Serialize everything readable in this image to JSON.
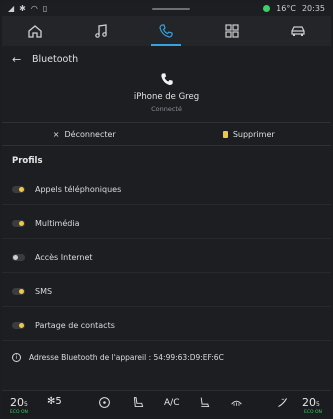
{
  "status": {
    "temp": "16°C",
    "time": "20:35"
  },
  "nav": {
    "tabs": [
      {
        "name": "home",
        "active": false
      },
      {
        "name": "music",
        "active": false
      },
      {
        "name": "phone",
        "active": true
      },
      {
        "name": "apps",
        "active": false
      },
      {
        "name": "vehicle",
        "active": false
      }
    ]
  },
  "header": {
    "title": "Bluetooth"
  },
  "device": {
    "name": "iPhone de Greg",
    "state": "Connecté"
  },
  "actions": {
    "disconnect": "Déconnecter",
    "delete": "Supprimer"
  },
  "profiles": {
    "title": "Profils",
    "items": [
      {
        "label": "Appels téléphoniques",
        "on": true
      },
      {
        "label": "Multimédia",
        "on": true
      },
      {
        "label": "Accès Internet",
        "on": false
      },
      {
        "label": "SMS",
        "on": true
      },
      {
        "label": "Partage de contacts",
        "on": true
      }
    ]
  },
  "info": {
    "address": "Adresse Bluetooth de l'appareil : 54:99:63:D9:EF:6C"
  },
  "bottom": {
    "temp_left": "20",
    "temp_left_decimal": "5",
    "fan": "5",
    "ac": "A/C",
    "temp_right": "20",
    "temp_right_decimal": "5",
    "eco": "ECO ON"
  },
  "colors": {
    "accent": "#36a3e0",
    "toggle_on": "#efc945",
    "status_green": "#3ecf6a"
  }
}
